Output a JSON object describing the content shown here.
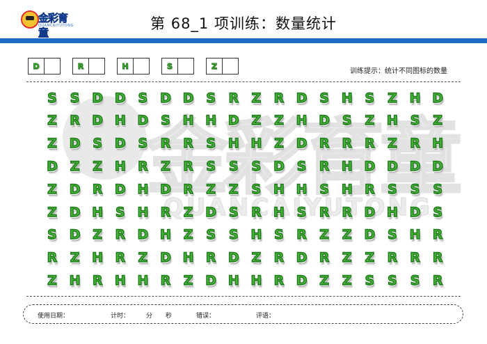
{
  "header": {
    "logo": {
      "brand": "金彩育童",
      "sub": "QUANCAIYUTONG"
    },
    "title": "第 68_1 项训练：数量统计"
  },
  "key": [
    "D",
    "R",
    "H",
    "S",
    "Z"
  ],
  "hint": "训练提示：统计不同图标的数量",
  "watermark": {
    "main": "金彩育童",
    "sub": "QUANCAIYUTONG"
  },
  "grid": [
    [
      "S",
      "S",
      "D",
      "D",
      "S",
      "D",
      "D",
      "S",
      "R",
      "Z",
      "R",
      "D",
      "S",
      "H",
      "S",
      "Z",
      "H",
      "D"
    ],
    [
      "Z",
      "R",
      "D",
      "H",
      "D",
      "S",
      "H",
      "H",
      "D",
      "Z",
      "Z",
      "H",
      "D",
      "S",
      "Z",
      "H",
      "S",
      "Z"
    ],
    [
      "Z",
      "D",
      "S",
      "D",
      "S",
      "R",
      "R",
      "S",
      "H",
      "H",
      "Z",
      "D",
      "R",
      "R",
      "R",
      "Z",
      "R",
      "H"
    ],
    [
      "D",
      "Z",
      "Z",
      "H",
      "R",
      "Z",
      "R",
      "S",
      "S",
      "S",
      "D",
      "S",
      "R",
      "H",
      "D",
      "D",
      "D",
      "D"
    ],
    [
      "Z",
      "D",
      "R",
      "D",
      "H",
      "D",
      "R",
      "Z",
      "Z",
      "S",
      "H",
      "H",
      "S",
      "H",
      "R",
      "S",
      "S",
      "S"
    ],
    [
      "Z",
      "D",
      "H",
      "S",
      "H",
      "R",
      "Z",
      "D",
      "S",
      "R",
      "H",
      "S",
      "R",
      "R",
      "D",
      "H",
      "D",
      "S"
    ],
    [
      "S",
      "D",
      "Z",
      "R",
      "D",
      "H",
      "Z",
      "S",
      "S",
      "H",
      "S",
      "R",
      "Z",
      "Z",
      "D",
      "S",
      "H",
      "R"
    ],
    [
      "R",
      "Z",
      "H",
      "R",
      "Z",
      "D",
      "H",
      "R",
      "D",
      "Z",
      "R",
      "D",
      "R",
      "Z",
      "Z",
      "R",
      "R",
      "R"
    ],
    [
      "Z",
      "H",
      "R",
      "H",
      "H",
      "R",
      "Z",
      "D",
      "H",
      "H",
      "R",
      "D",
      "Z",
      "Z",
      "S",
      "S",
      "S",
      "R"
    ]
  ],
  "footer": {
    "date": "使用日期：",
    "time": "计时：",
    "min": "分",
    "sec": "秒",
    "errors": "错误：",
    "rating": "评语："
  },
  "colors": {
    "accent": "#1d6cc7",
    "glyph_fill": "#49b43a",
    "glyph_outline": "#1f7a1c"
  }
}
